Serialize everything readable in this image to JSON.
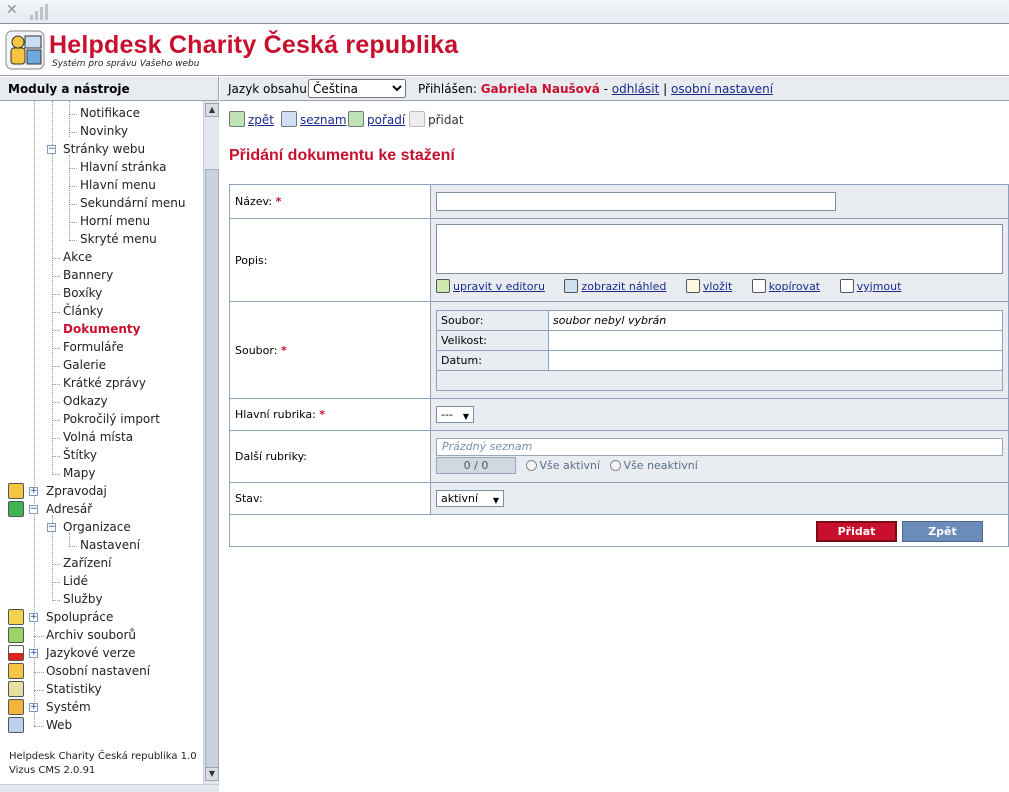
{
  "header": {
    "title": "Helpdesk Charity Česká republika",
    "subtitle": "Systém pro správu Vašeho webu"
  },
  "sidebar": {
    "heading": "Moduly a nástroje",
    "items": [
      {
        "label": "Notifikace"
      },
      {
        "label": "Novinky"
      },
      {
        "label": "Stránky webu"
      },
      {
        "label": "Hlavní stránka"
      },
      {
        "label": "Hlavní menu"
      },
      {
        "label": "Sekundární menu"
      },
      {
        "label": "Horní menu"
      },
      {
        "label": "Skryté menu"
      },
      {
        "label": "Akce"
      },
      {
        "label": "Bannery"
      },
      {
        "label": "Boxíky"
      },
      {
        "label": "Články"
      },
      {
        "label": "Dokumenty"
      },
      {
        "label": "Formuláře"
      },
      {
        "label": "Galerie"
      },
      {
        "label": "Krátké zprávy"
      },
      {
        "label": "Odkazy"
      },
      {
        "label": "Pokročilý import"
      },
      {
        "label": "Volná místa"
      },
      {
        "label": "Štítky"
      },
      {
        "label": "Mapy"
      },
      {
        "label": "Zpravodaj"
      },
      {
        "label": "Adresář"
      },
      {
        "label": "Organizace"
      },
      {
        "label": "Nastavení"
      },
      {
        "label": "Zařízení"
      },
      {
        "label": "Lidé"
      },
      {
        "label": "Služby"
      },
      {
        "label": "Spolupráce"
      },
      {
        "label": "Archiv souborů"
      },
      {
        "label": "Jazykové verze"
      },
      {
        "label": "Osobní nastavení"
      },
      {
        "label": "Statistiky"
      },
      {
        "label": "Systém"
      },
      {
        "label": "Web"
      }
    ],
    "footer_line1": "Helpdesk Charity Česká republika 1.0",
    "footer_line2": "Vizus CMS 2.0.91"
  },
  "topbar": {
    "language_label": "Jazyk obsahu:",
    "language_value": "Čeština",
    "logged_label": "Přihlášen:",
    "user_name": "Gabriela Naušová",
    "separator_dash": "-",
    "logout": "odhlásit",
    "separator_pipe": "|",
    "personal_settings": "osobní nastavení"
  },
  "toolbar": {
    "back": "zpět",
    "list": "seznam",
    "order": "pořadí",
    "add": "přidat"
  },
  "page_title": "Přidání dokumentu ke stažení",
  "form": {
    "name_label": "Název:",
    "required_mark": "*",
    "desc_label": "Popis:",
    "edit_in_editor": "upravit v editoru",
    "show_preview": "zobrazit náhled",
    "insert": "vložit",
    "copy": "kopírovat",
    "cut": "vyjmout",
    "file_label": "Soubor:",
    "file_sub_label": "Soubor:",
    "file_status": "soubor nebyl vybrán",
    "size_label": "Velikost:",
    "date_label": "Datum:",
    "main_category_label": "Hlavní rubrika:",
    "main_category_value": "---",
    "other_categories_label": "Další rubriky:",
    "empty_list": "Prázdný seznam",
    "counter": "0 / 0",
    "all_active": "Vše aktivní",
    "all_inactive": "Vše neaktivní",
    "state_label": "Stav:",
    "state_value": "aktivní",
    "submit": "Přidat",
    "cancel": "Zpět"
  },
  "colors": {
    "brand_red": "#c8102e",
    "link_blue": "#1b2a8a",
    "field_bg": "#e9edf2"
  }
}
